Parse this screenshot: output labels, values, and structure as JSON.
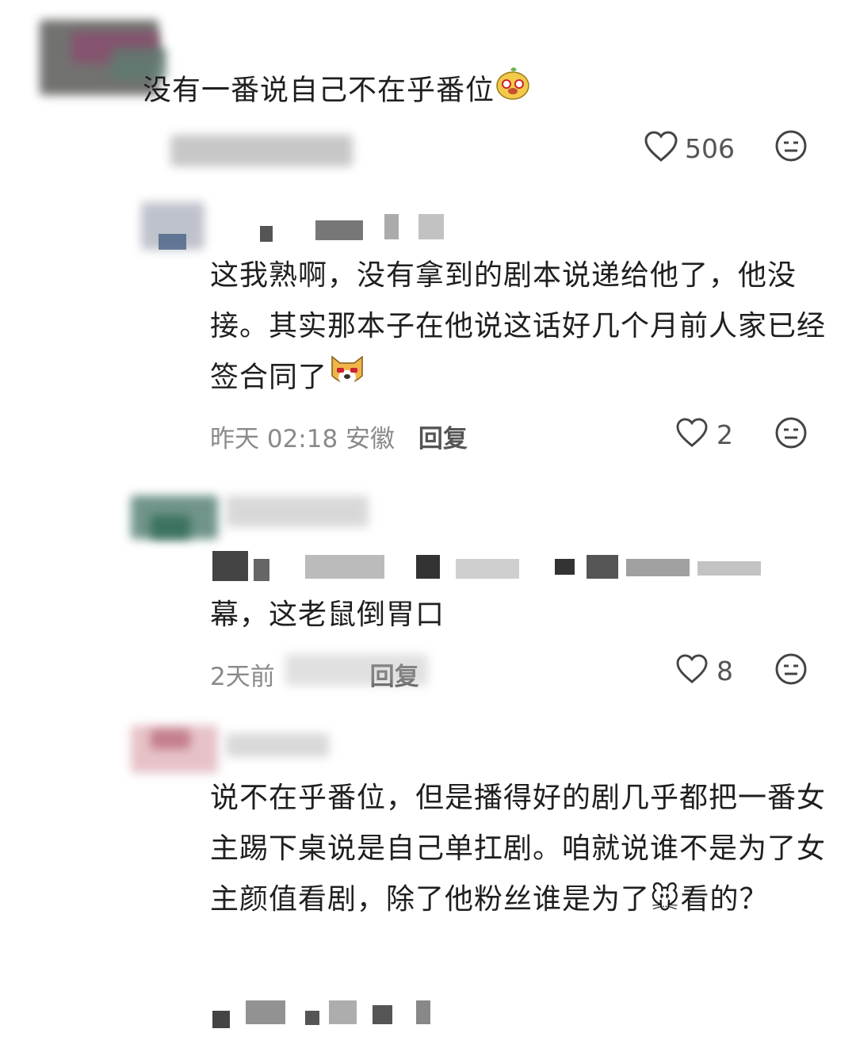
{
  "comments": [
    {
      "text": "没有一番说自己不在乎番位",
      "likes": "506"
    },
    {
      "text": "这我熟啊，没有拿到的剧本说递给他了，他没接。其实那本子在他说这话好几个月前人家已经签合同了",
      "time": "昨天 02:18 安徽",
      "reply_label": "回复",
      "likes": "2"
    },
    {
      "text_tail": "幕，这老鼠倒胃口",
      "time": "2天前",
      "reply_label": "回复",
      "likes": "8"
    },
    {
      "text": "说不在乎番位，但是播得好的剧几乎都把一番女主踢下桌说是自己单扛剧。咱就说谁不是为了女主颜值看剧，除了他粉丝谁是为了🐭看的？"
    }
  ],
  "icons": {
    "like": "heart-outline-icon",
    "menu": "neutral-face-icon"
  }
}
